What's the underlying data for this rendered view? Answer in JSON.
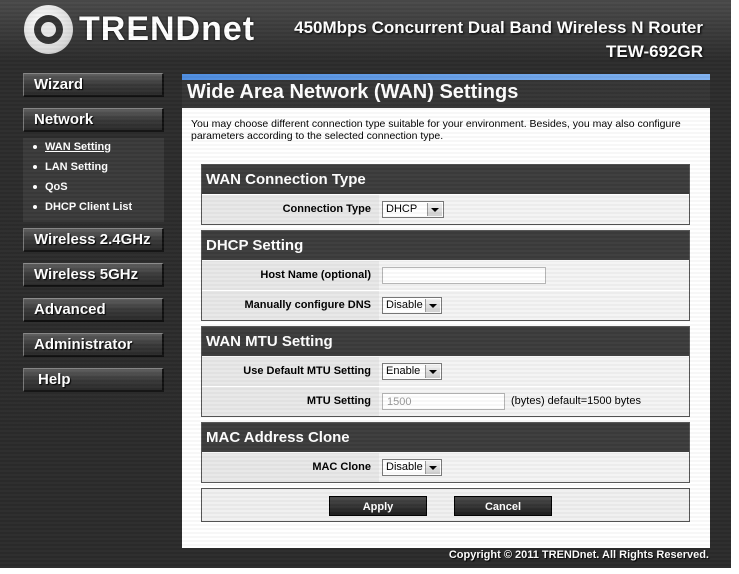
{
  "header": {
    "brand": "TRENDnet",
    "product_name": "450Mbps Concurrent Dual Band Wireless N Router",
    "model": "TEW-692GR"
  },
  "sidebar": {
    "items": [
      {
        "label": "Wizard"
      },
      {
        "label": "Network"
      },
      {
        "label": "Wireless 2.4GHz"
      },
      {
        "label": "Wireless 5GHz"
      },
      {
        "label": "Advanced"
      },
      {
        "label": "Administrator"
      },
      {
        "label": "Help"
      }
    ],
    "network_sub": [
      {
        "label": "WAN Setting",
        "active": true
      },
      {
        "label": "LAN Setting"
      },
      {
        "label": "QoS"
      },
      {
        "label": "DHCP Client List"
      }
    ]
  },
  "main": {
    "title": "Wide Area Network (WAN) Settings",
    "intro": "You may choose different connection type suitable for your environment. Besides, you may also configure parameters according to the selected connection type.",
    "wan_type": {
      "heading": "WAN Connection Type",
      "connection_label": "Connection Type",
      "connection_value": "DHCP"
    },
    "dhcp": {
      "heading": "DHCP Setting",
      "hostname_label": "Host Name (optional)",
      "hostname_value": "",
      "dns_label": "Manually configure DNS",
      "dns_value": "Disable"
    },
    "mtu": {
      "heading": "WAN MTU Setting",
      "default_label": "Use Default MTU Setting",
      "default_value": "Enable",
      "mtu_label": "MTU Setting",
      "mtu_placeholder": "1500",
      "mtu_suffix": "(bytes) default=1500 bytes"
    },
    "mac": {
      "heading": "MAC Address Clone",
      "clone_label": "MAC Clone",
      "clone_value": "Disable"
    },
    "buttons": {
      "apply": "Apply",
      "cancel": "Cancel"
    }
  },
  "footer": {
    "copyright": "Copyright © 2011 TRENDnet. All Rights Reserved."
  }
}
